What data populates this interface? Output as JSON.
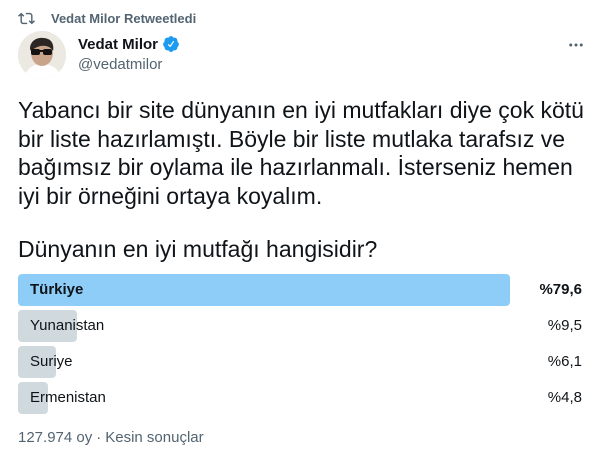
{
  "retweet": {
    "label": "Vedat Milor Retweetledi",
    "icon": "retweet-icon"
  },
  "author": {
    "display_name": "Vedat Milor",
    "handle": "@vedatmilor",
    "verified": true,
    "verified_color": "#1d9bf0"
  },
  "tweet": {
    "text": "Yabancı bir site dünyanın en iyi mutfakları diye çok kötü\nbir liste hazırlamıştı. Böyle bir liste mutlaka tarafsız ve\nbağımsız bir oylama ile hazırlanmalı. İsterseniz hemen\niyi bir örneğini ortaya koyalım."
  },
  "poll": {
    "question": "Dünyanın en iyi mutfağı hangisidir?",
    "winner_color": "#8ecdf7",
    "other_color": "#cfd9de",
    "options": [
      {
        "label": "Türkiye",
        "percent_label": "%79,6",
        "percent": 79.6,
        "winner": true
      },
      {
        "label": "Yunanistan",
        "percent_label": "%9,5",
        "percent": 9.5,
        "winner": false
      },
      {
        "label": "Suriye",
        "percent_label": "%6,1",
        "percent": 6.1,
        "winner": false
      },
      {
        "label": "Ermenistan",
        "percent_label": "%4,8",
        "percent": 4.8,
        "winner": false
      }
    ],
    "votes": "127.974 oy",
    "separator": "·",
    "status": "Kesin sonuçlar"
  }
}
